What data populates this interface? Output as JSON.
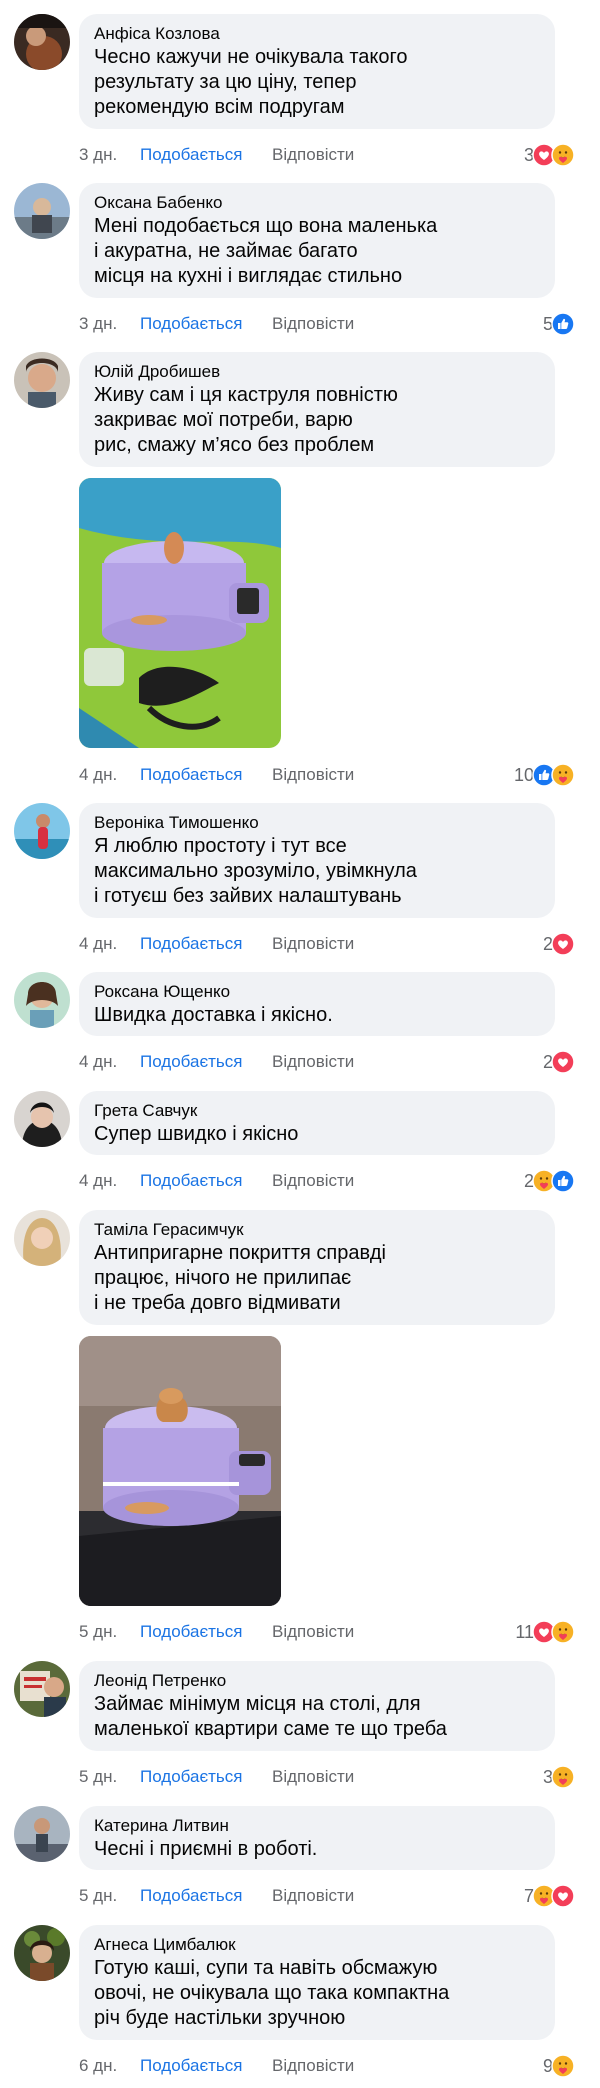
{
  "comments": [
    {
      "author": "Анфіса Козлова",
      "text": "Чесно кажучи не очікувала такого\nрезультату за цю ціну, тепер\nрекомендую всім подругам",
      "time": "3 дн.",
      "like_label": "Подобається",
      "reply_label": "Відповісти",
      "reaction_count": "3",
      "reactions": [
        "love-icon",
        "care-icon"
      ]
    },
    {
      "author": "Оксана Бабенко",
      "text": "Мені подобається що вона маленька\nі акуратна, не займає багато\nмісця на кухні і виглядає стильно",
      "time": "3 дн.",
      "like_label": "Подобається",
      "reply_label": "Відповісти",
      "reaction_count": "5",
      "reactions": [
        "like-icon"
      ]
    },
    {
      "author": "Юлій Дробишев",
      "text": "Живу сам і ця каструля повністю\nзакриває мої потреби, варю\nрис, смажу м’ясо без проблем",
      "time": "4 дн.",
      "like_label": "Подобається",
      "reply_label": "Відповісти",
      "reaction_count": "10",
      "reactions": [
        "like-icon",
        "care-icon"
      ],
      "has_photo": true
    },
    {
      "author": "Вероніка Тимошенко",
      "text": "Я люблю простоту і тут все\nмаксимально зрозуміло, увімкнула\nі готуєш без зайвих налаштувань",
      "time": "4 дн.",
      "like_label": "Подобається",
      "reply_label": "Відповісти",
      "reaction_count": "2",
      "reactions": [
        "love-icon"
      ]
    },
    {
      "author": "Роксана Ющенко",
      "text": "Швидка доставка і якісно.",
      "time": "4 дн.",
      "like_label": "Подобається",
      "reply_label": "Відповісти",
      "reaction_count": "2",
      "reactions": [
        "love-icon"
      ]
    },
    {
      "author": "Грета Савчук",
      "text": "Супер швидко і якісно",
      "time": "4 дн.",
      "like_label": "Подобається",
      "reply_label": "Відповісти",
      "reaction_count": "2",
      "reactions": [
        "care-icon",
        "like-icon"
      ]
    },
    {
      "author": "Таміла Герасимчук",
      "text": "Антипригарне покриття справді\nпрацює, нічого не прилипає\nі не треба довго відмивати",
      "time": "5 дн.",
      "like_label": "Подобається",
      "reply_label": "Відповісти",
      "reaction_count": "11",
      "reactions": [
        "love-icon",
        "care-icon"
      ],
      "has_photo": true
    },
    {
      "author": "Леонід Петренко",
      "text": "Займає мінімум місця на столі, для\nмаленької квартири саме те що треба",
      "time": "5 дн.",
      "like_label": "Подобається",
      "reply_label": "Відповісти",
      "reaction_count": "3",
      "reactions": [
        "care-icon"
      ]
    },
    {
      "author": "Катерина Литвин",
      "text": "Чесні і приємні в роботі.",
      "time": "5 дн.",
      "like_label": "Подобається",
      "reply_label": "Відповісти",
      "reaction_count": "7",
      "reactions": [
        "care-icon",
        "love-icon"
      ]
    },
    {
      "author": "Агнеса Цимбалюк",
      "text": "Готую каші, супи та навіть обсмажую\nовочі, не очікувала що така компактна\nріч буде настільки зручною",
      "time": "6 дн.",
      "like_label": "Подобається",
      "reply_label": "Відповісти",
      "reaction_count": "9",
      "reactions": [
        "care-icon"
      ]
    }
  ],
  "colors": {
    "bubble": "#f0f2f5",
    "meta": "#65676b",
    "like_link": "#1b74e4",
    "like_reaction": "#1877f2",
    "love_reaction": "#f33e58",
    "care_reaction": "#f7b125"
  }
}
